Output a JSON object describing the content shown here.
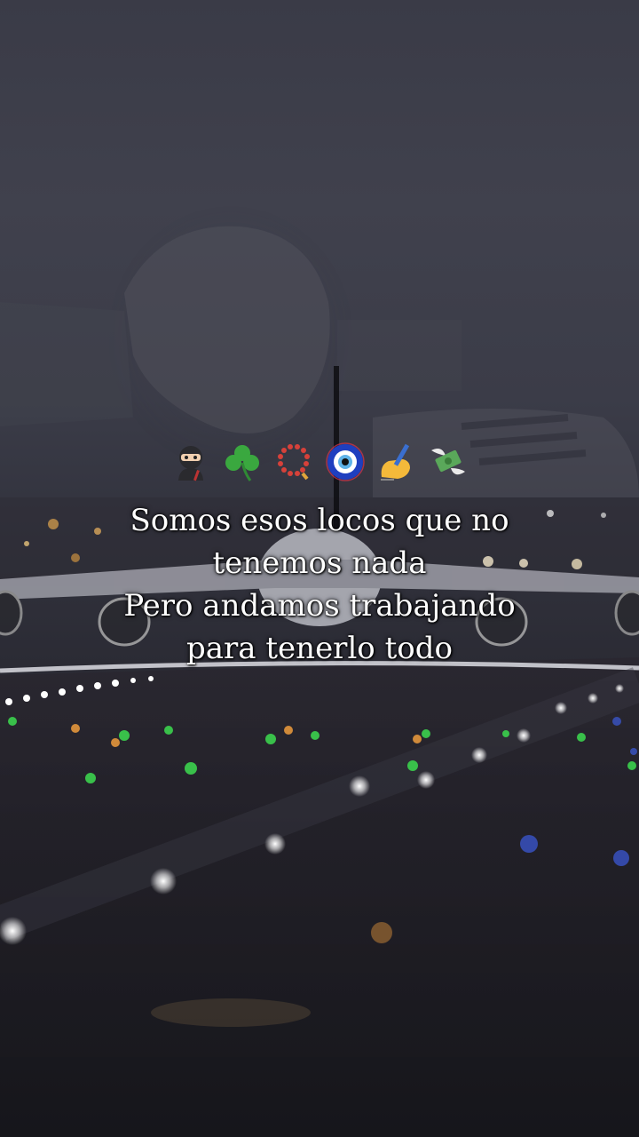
{
  "caption": {
    "line1": "Somos esos locos que no",
    "line2": "tenemos nada",
    "line3": "Pero andamos trabajando",
    "line4": "para tenerlo todo"
  },
  "emojis": [
    "ninja-icon",
    "shamrock-icon",
    "prayer-beads-icon",
    "nazar-amulet-icon",
    "writing-hand-icon",
    "money-with-wings-icon"
  ],
  "colors": {
    "text": "#ffffff",
    "background_top": "#3f404c",
    "background_bottom": "#18181d",
    "runway_green": "#39c04a",
    "runway_white": "#f4f4f4"
  }
}
